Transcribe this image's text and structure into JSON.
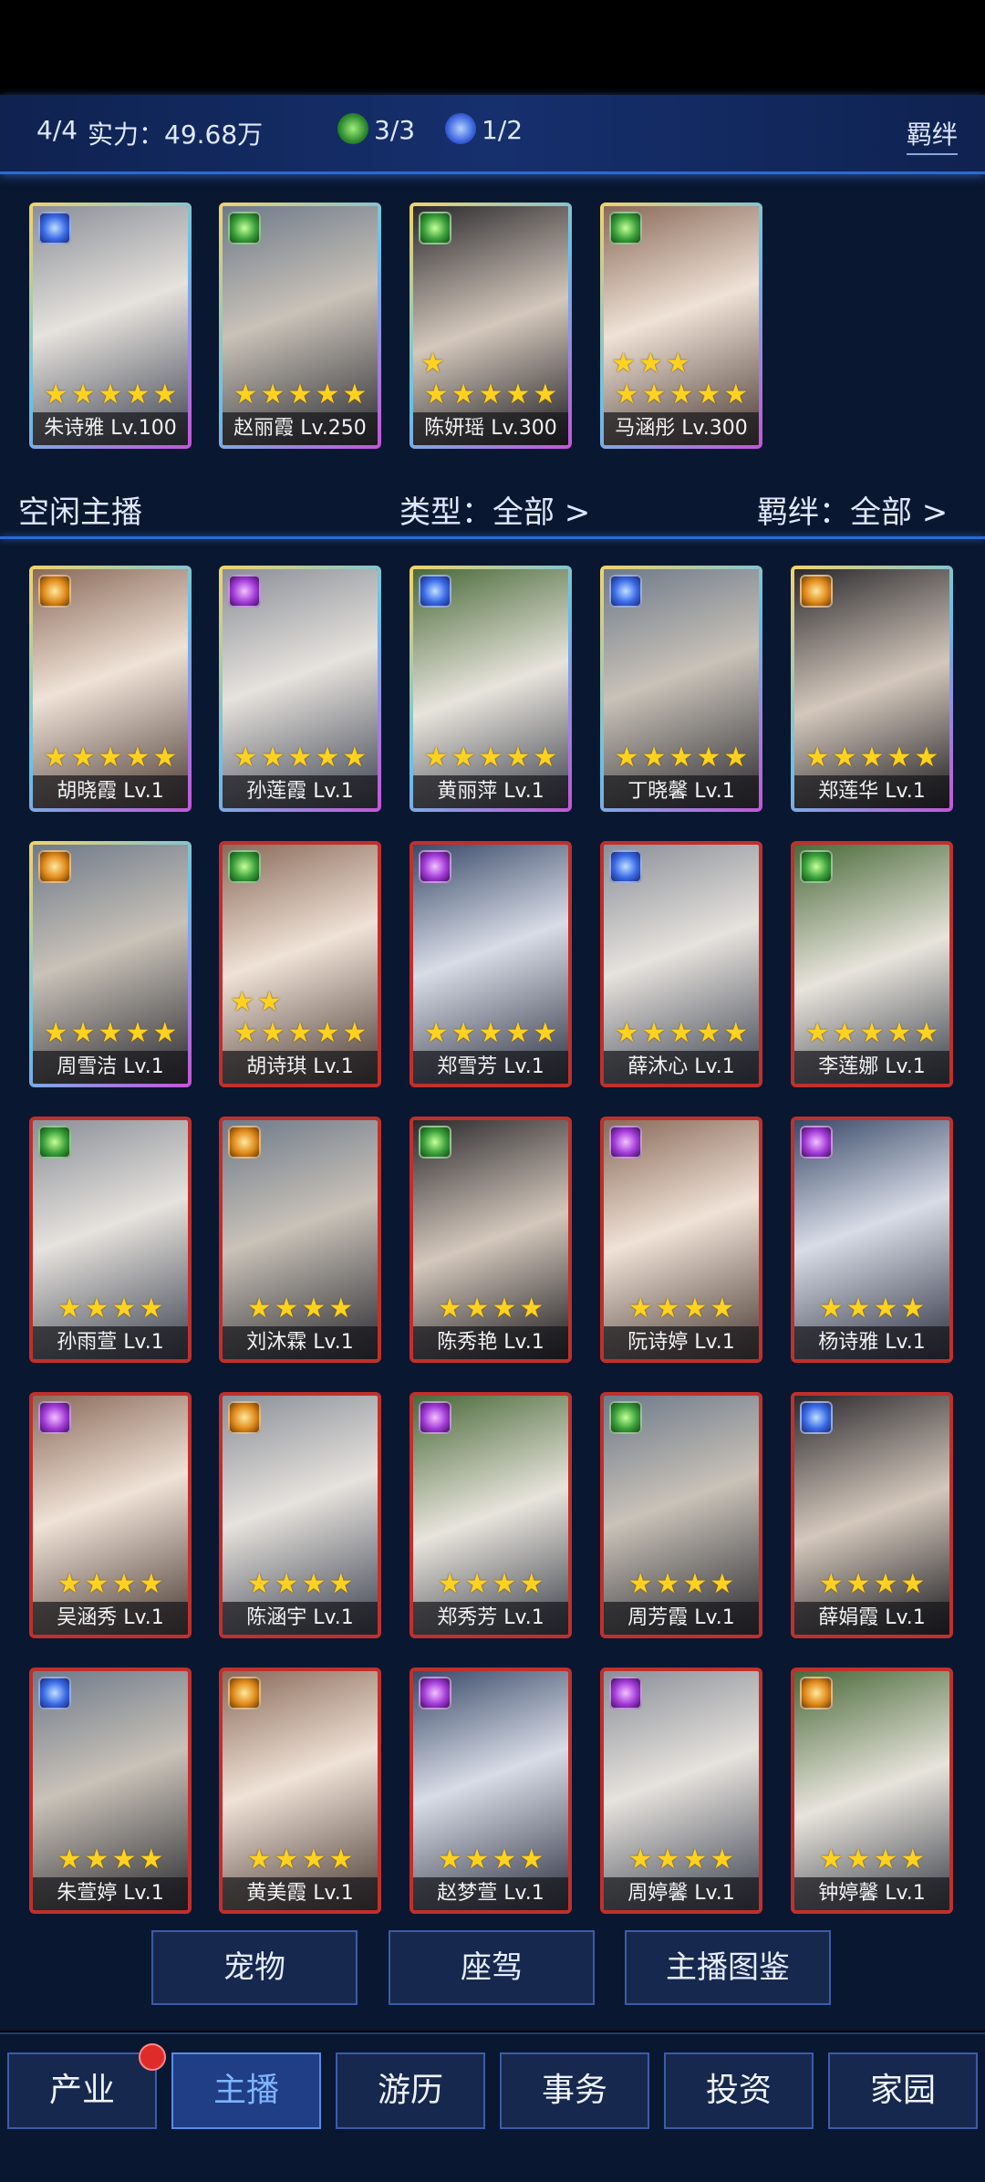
{
  "header": {
    "count": "4/4",
    "power_label": "实力：",
    "power_value": "49.68万",
    "green_bond": "3/3",
    "blue_bond": "1/2",
    "bond_link": "羁绊"
  },
  "team": [
    {
      "name": "朱诗雅 Lv.100",
      "stars": 5,
      "extra": 0,
      "orb": "blue"
    },
    {
      "name": "赵丽霞 Lv.250",
      "stars": 5,
      "extra": 0,
      "orb": "green"
    },
    {
      "name": "陈妍瑶 Lv.300",
      "stars": 5,
      "extra": 1,
      "orb": "green"
    },
    {
      "name": "马涵彤 Lv.300",
      "stars": 5,
      "extra": 3,
      "orb": "green"
    }
  ],
  "idle": {
    "title": "空闲主播",
    "type_filter": "类型：全部 >",
    "bond_filter": "羁绊：全部 >"
  },
  "hosts": [
    {
      "name": "胡晓霞 Lv.1",
      "stars": 5,
      "extra": 0,
      "orb": "gold",
      "frame": "gold2"
    },
    {
      "name": "孙莲霞 Lv.1",
      "stars": 5,
      "extra": 0,
      "orb": "purple",
      "frame": "gold2"
    },
    {
      "name": "黄丽萍 Lv.1",
      "stars": 5,
      "extra": 0,
      "orb": "blue",
      "frame": "gold2"
    },
    {
      "name": "丁晓馨 Lv.1",
      "stars": 5,
      "extra": 0,
      "orb": "blue",
      "frame": "gold2"
    },
    {
      "name": "郑莲华 Lv.1",
      "stars": 5,
      "extra": 0,
      "orb": "gold",
      "frame": "gold2"
    },
    {
      "name": "周雪洁 Lv.1",
      "stars": 5,
      "extra": 0,
      "orb": "gold",
      "frame": "gold2"
    },
    {
      "name": "胡诗琪 Lv.1",
      "stars": 5,
      "extra": 2,
      "orb": "green",
      "frame": "red"
    },
    {
      "name": "郑雪芳 Lv.1",
      "stars": 5,
      "extra": 0,
      "orb": "purple",
      "frame": "red"
    },
    {
      "name": "薛沐心 Lv.1",
      "stars": 5,
      "extra": 0,
      "orb": "blue",
      "frame": "red"
    },
    {
      "name": "李莲娜 Lv.1",
      "stars": 5,
      "extra": 0,
      "orb": "green",
      "frame": "red"
    },
    {
      "name": "孙雨萱 Lv.1",
      "stars": 4,
      "extra": 0,
      "orb": "green",
      "frame": "red"
    },
    {
      "name": "刘沐霖 Lv.1",
      "stars": 4,
      "extra": 0,
      "orb": "gold",
      "frame": "red"
    },
    {
      "name": "陈秀艳 Lv.1",
      "stars": 4,
      "extra": 0,
      "orb": "green",
      "frame": "red"
    },
    {
      "name": "阮诗婷 Lv.1",
      "stars": 4,
      "extra": 0,
      "orb": "purple",
      "frame": "red"
    },
    {
      "name": "杨诗雅 Lv.1",
      "stars": 4,
      "extra": 0,
      "orb": "purple",
      "frame": "red"
    },
    {
      "name": "吴涵秀 Lv.1",
      "stars": 4,
      "extra": 0,
      "orb": "purple",
      "frame": "red"
    },
    {
      "name": "陈涵宇 Lv.1",
      "stars": 4,
      "extra": 0,
      "orb": "gold",
      "frame": "red"
    },
    {
      "name": "郑秀芳 Lv.1",
      "stars": 4,
      "extra": 0,
      "orb": "purple",
      "frame": "red"
    },
    {
      "name": "周芳霞 Lv.1",
      "stars": 4,
      "extra": 0,
      "orb": "green",
      "frame": "red"
    },
    {
      "name": "薛娟霞 Lv.1",
      "stars": 4,
      "extra": 0,
      "orb": "blue",
      "frame": "red"
    },
    {
      "name": "朱萱婷 Lv.1",
      "stars": 4,
      "extra": 0,
      "orb": "blue",
      "frame": "red"
    },
    {
      "name": "黄美霞 Lv.1",
      "stars": 4,
      "extra": 0,
      "orb": "gold",
      "frame": "red"
    },
    {
      "name": "赵梦萱 Lv.1",
      "stars": 4,
      "extra": 0,
      "orb": "purple",
      "frame": "red"
    },
    {
      "name": "周婷馨 Lv.1",
      "stars": 4,
      "extra": 0,
      "orb": "purple",
      "frame": "red"
    },
    {
      "name": "钟婷馨 Lv.1",
      "stars": 4,
      "extra": 0,
      "orb": "gold",
      "frame": "red"
    }
  ],
  "sub_buttons": [
    "宠物",
    "座驾",
    "主播图鉴"
  ],
  "nav": [
    {
      "label": "产业",
      "badge": true,
      "active": false
    },
    {
      "label": "主播",
      "badge": false,
      "active": true
    },
    {
      "label": "游历",
      "badge": false,
      "active": false
    },
    {
      "label": "事务",
      "badge": false,
      "active": false
    },
    {
      "label": "投资",
      "badge": false,
      "active": false
    },
    {
      "label": "家园",
      "badge": false,
      "active": false
    }
  ],
  "colors": {
    "accent_blue": "#2a6ad8",
    "star": "#ffd21f",
    "red_frame": "#c0302c",
    "gold_frame": "#e6c55a",
    "active_nav_text": "#7fb4ff",
    "badge": "#e02b2b"
  }
}
